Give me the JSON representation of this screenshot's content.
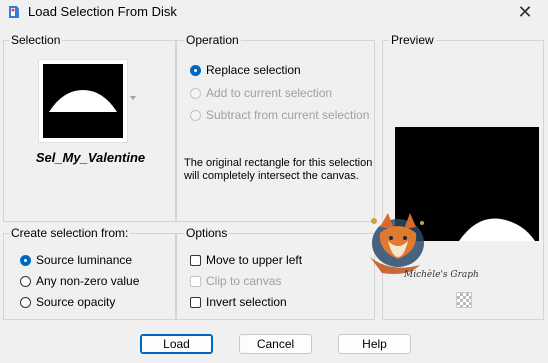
{
  "window": {
    "title": "Load Selection From Disk",
    "close_glyph": "✕"
  },
  "selection": {
    "group_label": "Selection",
    "name": "Sel_My_Valentine"
  },
  "operation": {
    "group_label": "Operation",
    "options": [
      {
        "label": "Replace selection",
        "selected": true,
        "enabled": true
      },
      {
        "label": "Add to current selection",
        "selected": false,
        "enabled": false
      },
      {
        "label": "Subtract from current selection",
        "selected": false,
        "enabled": false
      }
    ],
    "description": "The original rectangle for this selection will completely intersect the canvas."
  },
  "preview": {
    "group_label": "Preview"
  },
  "create_from": {
    "group_label": "Create selection from:",
    "options": [
      {
        "label": "Source luminance",
        "selected": true
      },
      {
        "label": "Any non-zero value",
        "selected": false
      },
      {
        "label": "Source opacity",
        "selected": false
      }
    ]
  },
  "options": {
    "group_label": "Options",
    "items": [
      {
        "label": "Move to upper left",
        "checked": false,
        "enabled": true
      },
      {
        "label": "Clip to canvas",
        "checked": false,
        "enabled": false
      },
      {
        "label": "Invert selection",
        "checked": false,
        "enabled": true
      }
    ]
  },
  "watermark": {
    "text": "Michèle's Graph"
  },
  "buttons": {
    "load": "Load",
    "cancel": "Cancel",
    "help": "Help"
  },
  "colors": {
    "accent": "#0067c0",
    "background": "#f0f0f0"
  }
}
